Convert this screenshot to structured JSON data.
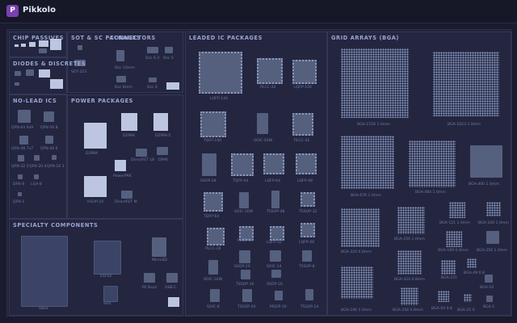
{
  "app": {
    "title": "Pikkolo",
    "logo_letter": "P"
  },
  "sections": {
    "chip_passives": "CHIP PASSIVES",
    "sot_sc": "SOT & SC PACKAGES",
    "connectors": "CONNECTORS",
    "diodes": "DIODES & DISCRETES",
    "noload": "NO-LEAD ICS",
    "power": "POWER PACKAGES",
    "specialty": "SPECIALTY COMPONENTS",
    "leaded": "LEADED IC PACKAGES",
    "bga": "GRID ARRAYS (BGA)"
  },
  "labels": {
    "sot": [
      "SOT-223"
    ],
    "connectors": [
      "Dsc 10mm",
      "Dsc 6.3",
      "Dsc 5",
      "Dsc 8mm",
      "Dsc 4"
    ],
    "noload": [
      "QFN-64 9x9",
      "QFN-56 8",
      "QFN-48 7x7",
      "QFN-40 6",
      "QFN-32 5",
      "QFN-20 4",
      "QFN-16 3",
      "DFN-8",
      "LGA-8",
      "QFN-1"
    ],
    "power": [
      "D3PAK",
      "D2PAK",
      "D2PAK-5",
      "DPAK",
      "DirectFET L8",
      "PowerPAK",
      "DirectFET M",
      "HSOP-20"
    ],
    "specialty": [
      "SBea",
      "ESP32",
      "SH4",
      "MicroSD",
      "RF Buzz",
      "USB-C"
    ],
    "leaded": [
      "LQFP-144",
      "PLCC-44",
      "LQFP-100",
      "TQFP-100",
      "SOIC-20W",
      "PLCC-32",
      "SSOP-28",
      "TQFP-44",
      "LQFP-64",
      "LQFP-48",
      "TQFP-64",
      "SOIC-16W",
      "TSSOP-48",
      "TSSOP-32",
      "PLCC-28",
      "PLCC-20",
      "LQFP-32",
      "LQFP-48",
      "PLCC-18",
      "SSOP-28",
      "SSOP-20",
      "SOIC-14",
      "TSSOP-8",
      "SOIC-16W",
      "TSSOP-16",
      "SSOP-16",
      "TSSOP-14",
      "TSSOP-16",
      "TSSOP-24",
      "SOIC-8",
      "TSSOP-20",
      "MSOP-10"
    ],
    "bga": [
      "BGA-1156 1.0mm",
      "BGA-1023 1.0mm",
      "BGA-676 1.0mm",
      "BGA-484 1.0mm",
      "BGA-400 1.0mm",
      "BGA-324 0.8mm",
      "BGA-256 1.0mm",
      "BGA-121 1.0mm",
      "BGA-100 1.0mm",
      "BGA-144 1.0mm",
      "BGA-169 0.8mm",
      "BGA-256 1.0mm",
      "BGA-324 0.8mm",
      "BGA-121",
      "BGA-49 0.8",
      "BGA-64 0.8",
      "BGA-196 1.0mm",
      "BGA-256 0.8mm",
      "BGA-64 0.8",
      "BGA-25 0.",
      "BGA-16",
      "BGA-1"
    ]
  },
  "colors": {
    "accent": "#7a3fb0",
    "bg": "#1a1b2e",
    "panel": "#24263f"
  }
}
